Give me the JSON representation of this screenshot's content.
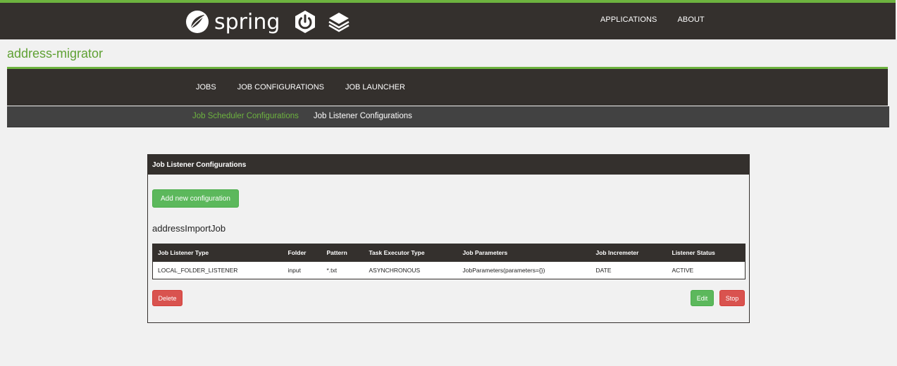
{
  "header": {
    "brand_text": "spring",
    "icons": [
      "spring-leaf-logo",
      "spring-boot-power-icon",
      "layers-stack-icon"
    ],
    "nav": [
      {
        "label": "APPLICATIONS"
      },
      {
        "label": "ABOUT"
      }
    ]
  },
  "app": {
    "title": "address-migrator"
  },
  "main_nav": {
    "items": [
      {
        "label": "JOBS"
      },
      {
        "label": "JOB CONFIGURATIONS"
      },
      {
        "label": "JOB LAUNCHER"
      }
    ]
  },
  "sub_nav": {
    "items": [
      {
        "label": "Job Scheduler Configurations",
        "active": false
      },
      {
        "label": "Job Listener Configurations",
        "active": true
      }
    ]
  },
  "panel": {
    "title": "Job Listener Configurations",
    "add_button": "Add new configuration",
    "job_name": "addressImportJob",
    "table": {
      "columns": [
        "Job Listener Type",
        "Folder",
        "Pattern",
        "Task Executor Type",
        "Job Parameters",
        "Job Incremeter",
        "Listener Status"
      ],
      "rows": [
        [
          "LOCAL_FOLDER_LISTENER",
          "input",
          "*.txt",
          "ASYNCHRONOUS",
          "JobParameters(parameters={})",
          "DATE",
          "ACTIVE"
        ]
      ]
    },
    "delete_button": "Delete",
    "edit_button": "Edit",
    "stop_button": "Stop"
  },
  "colors": {
    "brand_green": "#6db33f",
    "dark": "#34302d",
    "success": "#5cb85c",
    "danger": "#d9534f"
  }
}
